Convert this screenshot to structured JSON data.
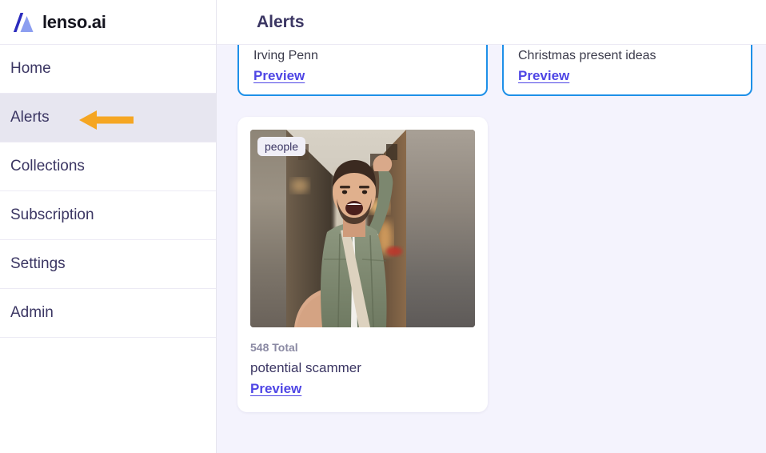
{
  "brand": {
    "name": "lenso.ai",
    "logo_icon": "lenso-logo-icon",
    "colors": {
      "dark": "#2b2bbd",
      "light": "#8c9ef0"
    }
  },
  "sidebar": {
    "items": [
      {
        "label": "Home",
        "active": false
      },
      {
        "label": "Alerts",
        "active": true
      },
      {
        "label": "Collections",
        "active": false
      },
      {
        "label": "Subscription",
        "active": false
      },
      {
        "label": "Settings",
        "active": false
      },
      {
        "label": "Admin",
        "active": false
      }
    ],
    "active_highlight_color": "#e7e6f0"
  },
  "annotation": {
    "arrow_icon": "arrow-left-icon",
    "arrow_color": "#f5a623",
    "points_to": "Alerts"
  },
  "header": {
    "title": "Alerts"
  },
  "alert_cards": [
    {
      "title": "Irving Penn",
      "preview_label": "Preview"
    },
    {
      "title": "Christmas present ideas",
      "preview_label": "Preview"
    }
  ],
  "result_card": {
    "badge": "people",
    "total": "548 Total",
    "name": "potential scammer",
    "preview_label": "Preview",
    "image_alt": "man-taking-selfie-in-street"
  },
  "colors": {
    "content_background": "#f4f3fd",
    "card_border_blue": "#1e90e8",
    "link_violet": "#4f46e5",
    "text_primary": "#3b3663",
    "text_muted": "#8a89a3"
  }
}
